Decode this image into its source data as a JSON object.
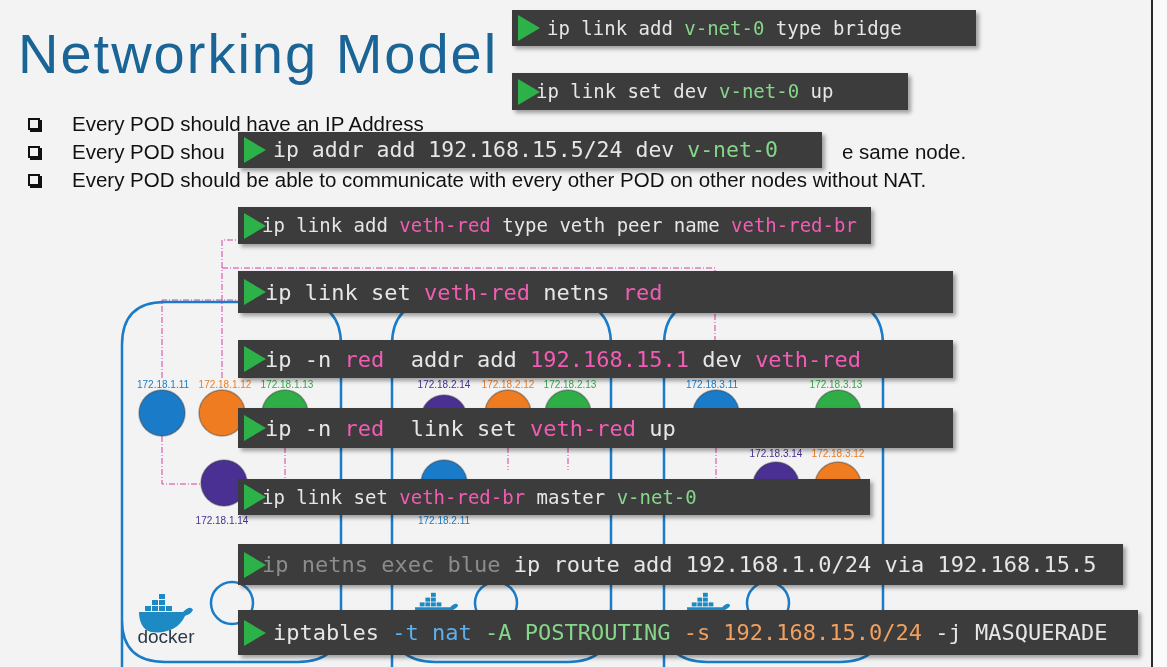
{
  "slide": {
    "title": "Networking Model",
    "bullets": [
      {
        "text": "Every POD should have an IP Address"
      },
      {
        "text": "Every POD shou",
        "tail": "e same node."
      },
      {
        "text": "Every POD should be able to communicate with every other POD on other nodes without NAT."
      }
    ],
    "nodes": [
      {
        "pods": [
          {
            "label": "172.18.1.11",
            "color": "#1a7cc9"
          },
          {
            "label": "172.18.1.12",
            "color": "#f07c22"
          },
          {
            "label": "172.18.1.13",
            "color": "#2fae48"
          },
          {
            "label": "172.18.1.14",
            "color": "#4a3093"
          }
        ],
        "logo": "docker"
      },
      {
        "pods": [
          {
            "label": "172.18.2.14",
            "color": "#4a3093"
          },
          {
            "label": "172.18.2.12",
            "color": "#f07c22"
          },
          {
            "label": "172.18.2.13",
            "color": "#2fae48"
          },
          {
            "label": "172.18.2.11",
            "color": "#1a7cc9"
          }
        ]
      },
      {
        "pods": [
          {
            "label": "172.18.3.11",
            "color": "#1a7cc9"
          },
          {
            "label": "172.18.3.13",
            "color": "#2fae48"
          },
          {
            "label": "172.18.3.14",
            "color": "#4a3093"
          },
          {
            "label": "172.18.3.12",
            "color": "#f07c22"
          }
        ]
      }
    ]
  },
  "commands": [
    {
      "segments": [
        {
          "text": "ip link add ",
          "color": "#e6e6e6"
        },
        {
          "text": "v-net-0",
          "color": "#86d68a"
        },
        {
          "text": " type bridge",
          "color": "#e6e6e6"
        }
      ]
    },
    {
      "segments": [
        {
          "text": "ip link set dev ",
          "color": "#e6e6e6"
        },
        {
          "text": "v-net-0",
          "color": "#86d68a"
        },
        {
          "text": " up",
          "color": "#e6e6e6"
        }
      ]
    },
    {
      "segments": [
        {
          "text": "ip addr add 192.168.15.5/24 dev ",
          "color": "#e6e6e6"
        },
        {
          "text": "v-net-0",
          "color": "#86d68a"
        }
      ]
    },
    {
      "segments": [
        {
          "text": "ip link add ",
          "color": "#e6e6e6"
        },
        {
          "text": "veth-red",
          "color": "#f25cb4"
        },
        {
          "text": " type veth peer name ",
          "color": "#e6e6e6"
        },
        {
          "text": "veth-red-br",
          "color": "#f25cb4"
        }
      ]
    },
    {
      "segments": [
        {
          "text": "ip link set ",
          "color": "#e6e6e6"
        },
        {
          "text": "veth-red",
          "color": "#f25cb4"
        },
        {
          "text": " netns ",
          "color": "#e6e6e6"
        },
        {
          "text": "red",
          "color": "#f25cb4"
        }
      ]
    },
    {
      "segments": [
        {
          "text": "ip -n ",
          "color": "#e6e6e6"
        },
        {
          "text": "red",
          "color": "#f25cb4"
        },
        {
          "text": "  addr add ",
          "color": "#e6e6e6"
        },
        {
          "text": "192.168.15.1",
          "color": "#f25cb4"
        },
        {
          "text": " dev ",
          "color": "#e6e6e6"
        },
        {
          "text": "veth-red",
          "color": "#f25cb4"
        }
      ]
    },
    {
      "segments": [
        {
          "text": "ip -n ",
          "color": "#e6e6e6"
        },
        {
          "text": "red",
          "color": "#f25cb4"
        },
        {
          "text": "  link set ",
          "color": "#e6e6e6"
        },
        {
          "text": "veth-red",
          "color": "#f25cb4"
        },
        {
          "text": " up",
          "color": "#e6e6e6"
        }
      ]
    },
    {
      "segments": [
        {
          "text": "ip link set ",
          "color": "#e6e6e6"
        },
        {
          "text": "veth-red-br",
          "color": "#f25cb4"
        },
        {
          "text": " master ",
          "color": "#e6e6e6"
        },
        {
          "text": "v-net-0",
          "color": "#86d68a"
        }
      ]
    },
    {
      "segments": [
        {
          "text": "ip netns exec blue ",
          "color": "#8c8c8c"
        },
        {
          "text": "ip route add 192.168.1.0/24 via 192.168.15.5",
          "color": "#e6e6e6"
        }
      ]
    },
    {
      "segments": [
        {
          "text": "iptables ",
          "color": "#e6e6e6"
        },
        {
          "text": "-t nat",
          "color": "#5cb0ec"
        },
        {
          "text": " -A POSTROUTING",
          "color": "#86d68a"
        },
        {
          "text": " -s 192.168.15.0/24",
          "color": "#f0a060"
        },
        {
          "text": " -j MASQUERADE",
          "color": "#e6e6e6"
        }
      ]
    }
  ]
}
